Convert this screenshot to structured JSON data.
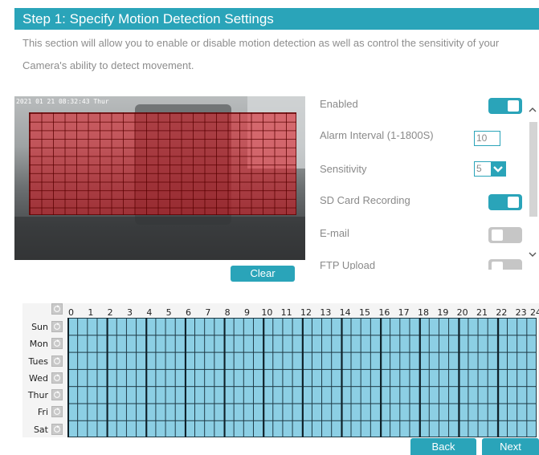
{
  "header": {
    "title": "Step 1: Specify Motion Detection Settings"
  },
  "description": {
    "line1": "This section will allow you to enable or disable motion detection as well as control the sensitivity of your",
    "line2": "Camera's ability to detect movement."
  },
  "camera": {
    "timestamp": "2021 01 21 08:32:43 Thur"
  },
  "clear_label": "Clear",
  "settings": {
    "enabled": {
      "label": "Enabled",
      "on": true
    },
    "alarm_interval": {
      "label": "Alarm Interval (1-1800S)",
      "value": "10"
    },
    "sensitivity": {
      "label": "Sensitivity",
      "value": "5"
    },
    "sd_card_recording": {
      "label": "SD Card Recording",
      "on": true
    },
    "email": {
      "label": "E-mail",
      "on": false
    },
    "ftp_upload": {
      "label": "FTP Upload",
      "on": false
    }
  },
  "schedule": {
    "hours": [
      "0",
      "1",
      "2",
      "3",
      "4",
      "5",
      "6",
      "7",
      "8",
      "9",
      "10",
      "11",
      "12",
      "13",
      "14",
      "15",
      "16",
      "17",
      "18",
      "19",
      "20",
      "21",
      "22",
      "23",
      "24"
    ],
    "days": [
      "Sun",
      "Mon",
      "Tues",
      "Wed",
      "Thur",
      "Fri",
      "Sat"
    ],
    "fill_color": "#8ccfe4"
  },
  "footer": {
    "back_label": "Back",
    "next_label": "Next"
  },
  "colors": {
    "accent": "#2aa4b9",
    "motion_grid": "#dc141e"
  }
}
